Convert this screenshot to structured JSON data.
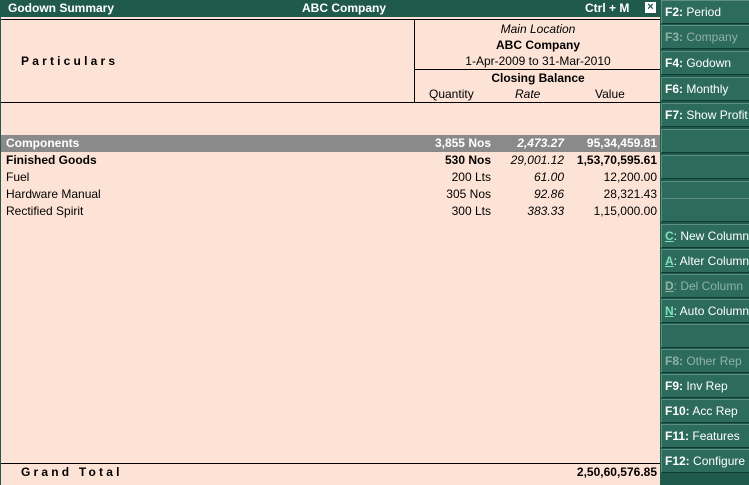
{
  "title_bar": {
    "left": "Godown Summary",
    "center": "ABC Company",
    "shortcut": "Ctrl + M",
    "close": "×"
  },
  "header": {
    "particulars_label": "Particulars",
    "location": "Main Location",
    "company": "ABC Company",
    "period": "1-Apr-2009 to 31-Mar-2010",
    "closing_balance": "Closing Balance",
    "col_quantity": "Quantity",
    "col_rate": "Rate",
    "col_value": "Value"
  },
  "rows": [
    {
      "name": "Components",
      "qty": "3,855 Nos",
      "rate": "2,473.27",
      "value": "95,34,459.81"
    },
    {
      "name": "Finished Goods",
      "qty": "530 Nos",
      "rate": "29,001.12",
      "value": "1,53,70,595.61"
    },
    {
      "name": "Fuel",
      "qty": "200 Lts",
      "rate": "61.00",
      "value": "12,200.00"
    },
    {
      "name": "Hardware Manual",
      "qty": "305 Nos",
      "rate": "92.86",
      "value": "28,321.43"
    },
    {
      "name": "Rectified Spirit",
      "qty": "300 Lts",
      "rate": "383.33",
      "value": "1,15,000.00"
    }
  ],
  "grand_total": {
    "label": "Grand Total",
    "value": "2,50,60,576.85"
  },
  "sidebar": {
    "f2": {
      "key": "F2:",
      "label": "Period"
    },
    "f3": {
      "key": "F3:",
      "label": "Company"
    },
    "f4": {
      "key": "F4:",
      "label": "Godown"
    },
    "f6": {
      "key": "F6:",
      "label": "Monthly"
    },
    "f7": {
      "key": "F7:",
      "label": "Show Profit"
    },
    "c": {
      "key": "C",
      "label": ": New Column"
    },
    "a": {
      "key": "A",
      "label": ": Alter Column"
    },
    "d": {
      "key": "D",
      "label": ": Del Column"
    },
    "n": {
      "key": "N",
      "label": ": Auto Column"
    },
    "f8": {
      "key": "F8:",
      "label": "Other Rep"
    },
    "f9": {
      "key": "F9:",
      "label": "Inv Rep"
    },
    "f10": {
      "key": "F10:",
      "label": "Acc Rep"
    },
    "f11": {
      "key": "F11:",
      "label": "Features"
    },
    "f12": {
      "key": "F12:",
      "label": "Configure"
    }
  },
  "colors": {
    "bar": "#1f5a4c",
    "background": "#fde3d6",
    "selected_row": "#8a8a8a",
    "hotkey": "#7fe0c0"
  }
}
